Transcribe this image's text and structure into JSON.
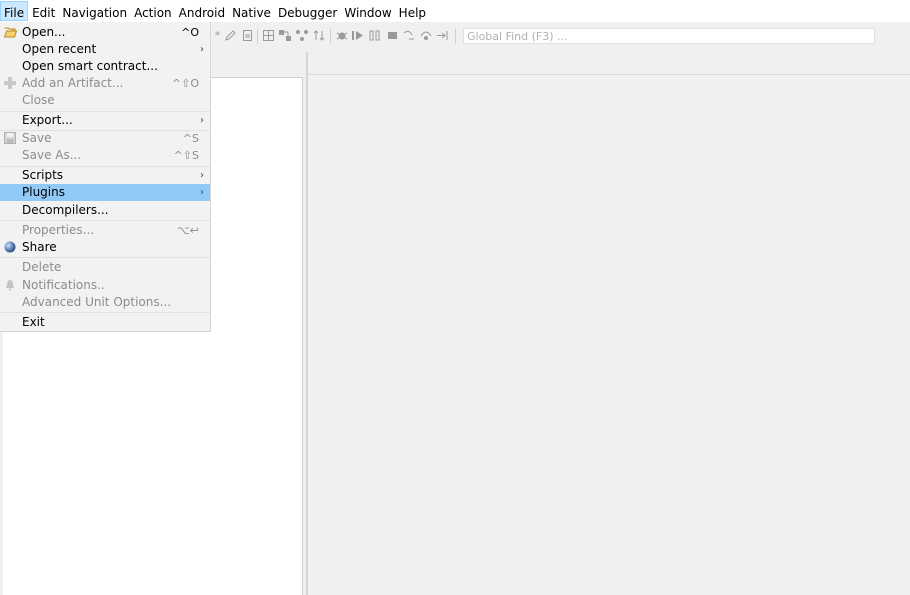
{
  "menubar": {
    "items": [
      {
        "label": "File",
        "active": true
      },
      {
        "label": "Edit"
      },
      {
        "label": "Navigation"
      },
      {
        "label": "Action"
      },
      {
        "label": "Android"
      },
      {
        "label": "Native"
      },
      {
        "label": "Debugger"
      },
      {
        "label": "Window"
      },
      {
        "label": "Help"
      }
    ]
  },
  "toolbar": {
    "global_find_placeholder": "Global Find (F3) ..."
  },
  "file_menu": {
    "items": [
      {
        "label": "Open...",
        "shortcut": "^O",
        "icon": "folder-open-icon"
      },
      {
        "label": "Open recent",
        "submenu": true
      },
      {
        "label": "Open smart contract..."
      },
      {
        "label": "Add an Artifact...",
        "shortcut": "^⇧O",
        "disabled": true,
        "icon": "plus-icon"
      },
      {
        "label": "Close",
        "disabled": true
      },
      {
        "label": "Export...",
        "submenu": true
      },
      {
        "label": "Save",
        "shortcut": "^S",
        "disabled": true,
        "icon": "floppy-disk-icon"
      },
      {
        "label": "Save As...",
        "shortcut": "^⇧S",
        "disabled": true
      },
      {
        "label": "Scripts",
        "submenu": true
      },
      {
        "label": "Plugins",
        "submenu": true,
        "selected": true
      },
      {
        "label": "Decompilers..."
      },
      {
        "label": "Properties...",
        "shortcut": "⌥↩",
        "disabled": true
      },
      {
        "label": "Share",
        "icon": "globe-icon"
      },
      {
        "label": "Delete",
        "disabled": true
      },
      {
        "label": "Notifications..",
        "disabled": true,
        "icon": "bell-icon"
      },
      {
        "label": "Advanced Unit Options...",
        "disabled": true
      },
      {
        "label": "Exit"
      }
    ]
  },
  "colors": {
    "selection": "#91c9f7",
    "menu_background": "#f2f2f2",
    "disabled_text": "#8c8c8c"
  }
}
